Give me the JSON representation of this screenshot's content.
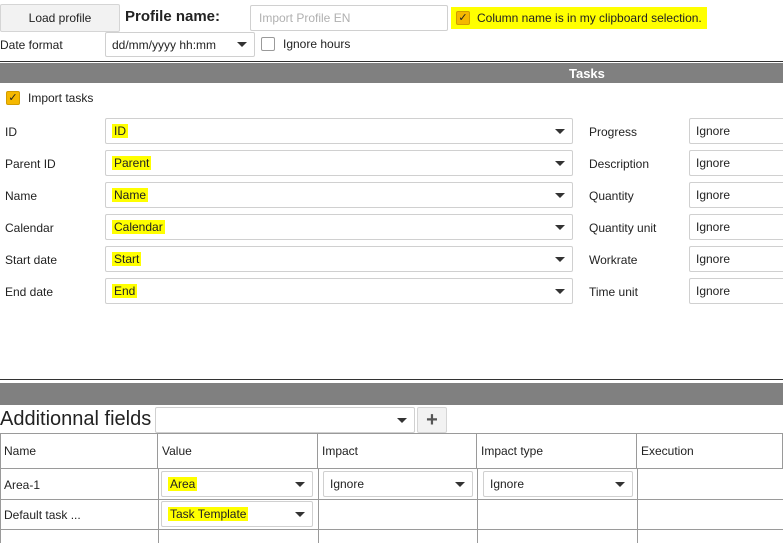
{
  "toolbar": {
    "load_profile": "Load profile",
    "profile_name_label": "Profile name:",
    "profile_name_placeholder": "Import Profile EN",
    "clipboard_checkbox_label": "Column name is in my clipboard selection.",
    "date_format_label": "Date format",
    "date_format_value": "dd/mm/yyyy hh:mm",
    "ignore_hours_label": "Ignore hours"
  },
  "tasks": {
    "section_title": "Tasks",
    "import_tasks_label": "Import tasks",
    "left_fields": [
      {
        "label": "ID",
        "value": "ID"
      },
      {
        "label": "Parent ID",
        "value": "Parent"
      },
      {
        "label": "Name",
        "value": "Name"
      },
      {
        "label": "Calendar",
        "value": "Calendar"
      },
      {
        "label": "Start date",
        "value": "Start"
      },
      {
        "label": "End date",
        "value": "End"
      }
    ],
    "right_fields": [
      {
        "label": "Progress",
        "value": "Ignore"
      },
      {
        "label": "Description",
        "value": "Ignore"
      },
      {
        "label": "Quantity",
        "value": "Ignore"
      },
      {
        "label": "Quantity unit",
        "value": "Ignore"
      },
      {
        "label": "Workrate",
        "value": "Ignore"
      },
      {
        "label": "Time unit",
        "value": "Ignore"
      }
    ]
  },
  "additional": {
    "title": "Additionnal fields",
    "add_symbol": "+",
    "columns": [
      "Name",
      "Value",
      "Impact",
      "Impact type",
      "Execution"
    ],
    "rows": [
      {
        "name": "Area-1",
        "value": "Area",
        "impact": "Ignore",
        "impact_type": "Ignore"
      },
      {
        "name": "Default task ...",
        "value": "Task Template"
      }
    ]
  },
  "colors": {
    "highlight": "#ffff00",
    "checkbox_accent": "#f5b800",
    "section_bar": "#808080"
  },
  "icons": [
    "dropdown-arrow-icon",
    "checkmark-icon",
    "plus-icon"
  ]
}
